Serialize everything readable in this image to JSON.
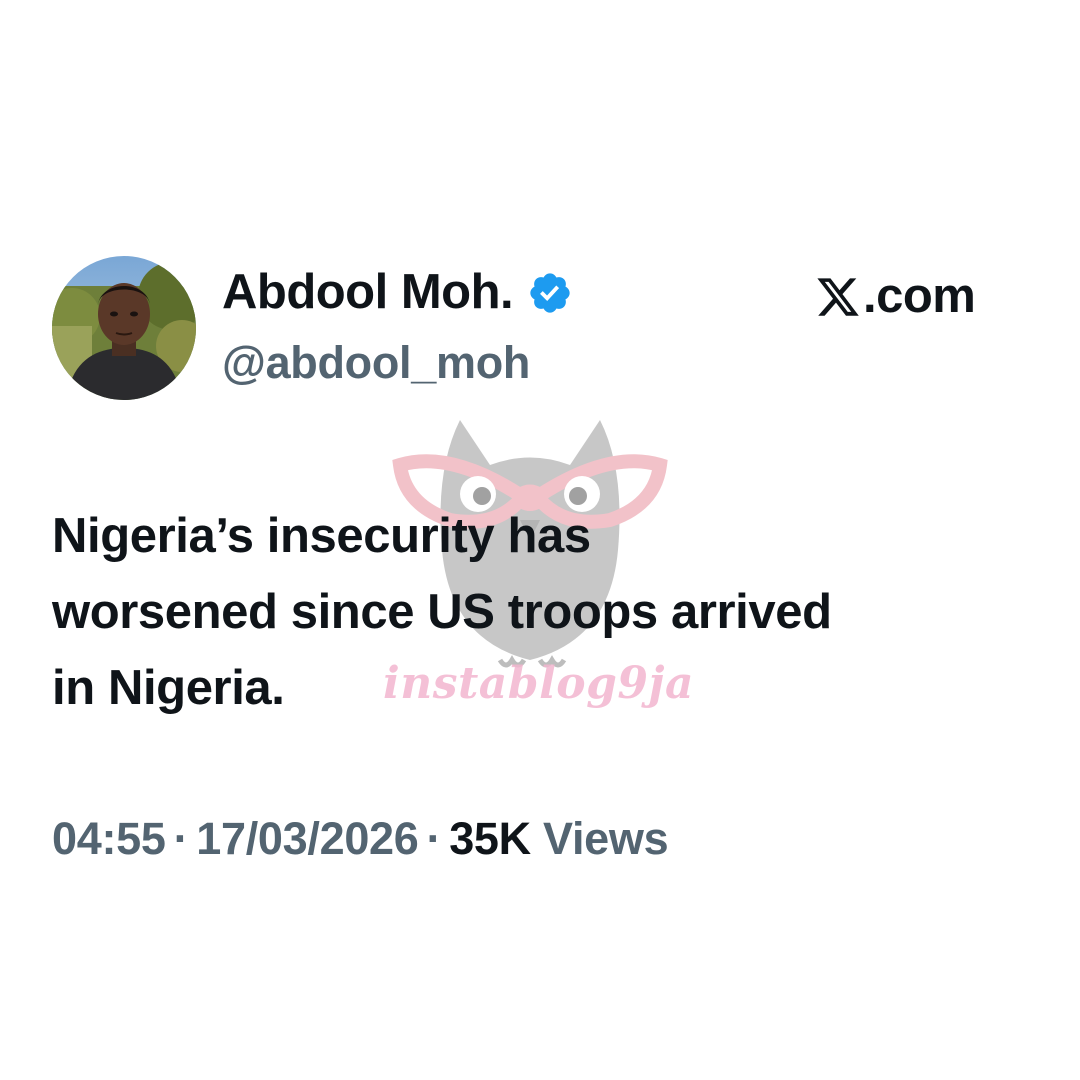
{
  "tweet": {
    "author": {
      "display_name": "Abdool Moh.",
      "handle": "@abdool_moh",
      "verified": true,
      "verified_color": "#1d9bf0"
    },
    "brand": {
      "icon": "x-logo-icon",
      "text": ".com"
    },
    "text": "Nigeria’s insecurity has\nworsened since US troops arrived\nin Nigeria.",
    "meta": {
      "time": "04:55",
      "separator": "·",
      "date": "17/03/2026",
      "views_count": "35K",
      "views_label": " Views"
    }
  },
  "watermark": {
    "text": "instablog9ja",
    "icon": "owl-icon",
    "color": "#f3b6cf"
  },
  "colors": {
    "text_primary": "#0f1419",
    "text_secondary": "#536471",
    "background": "#ffffff"
  }
}
